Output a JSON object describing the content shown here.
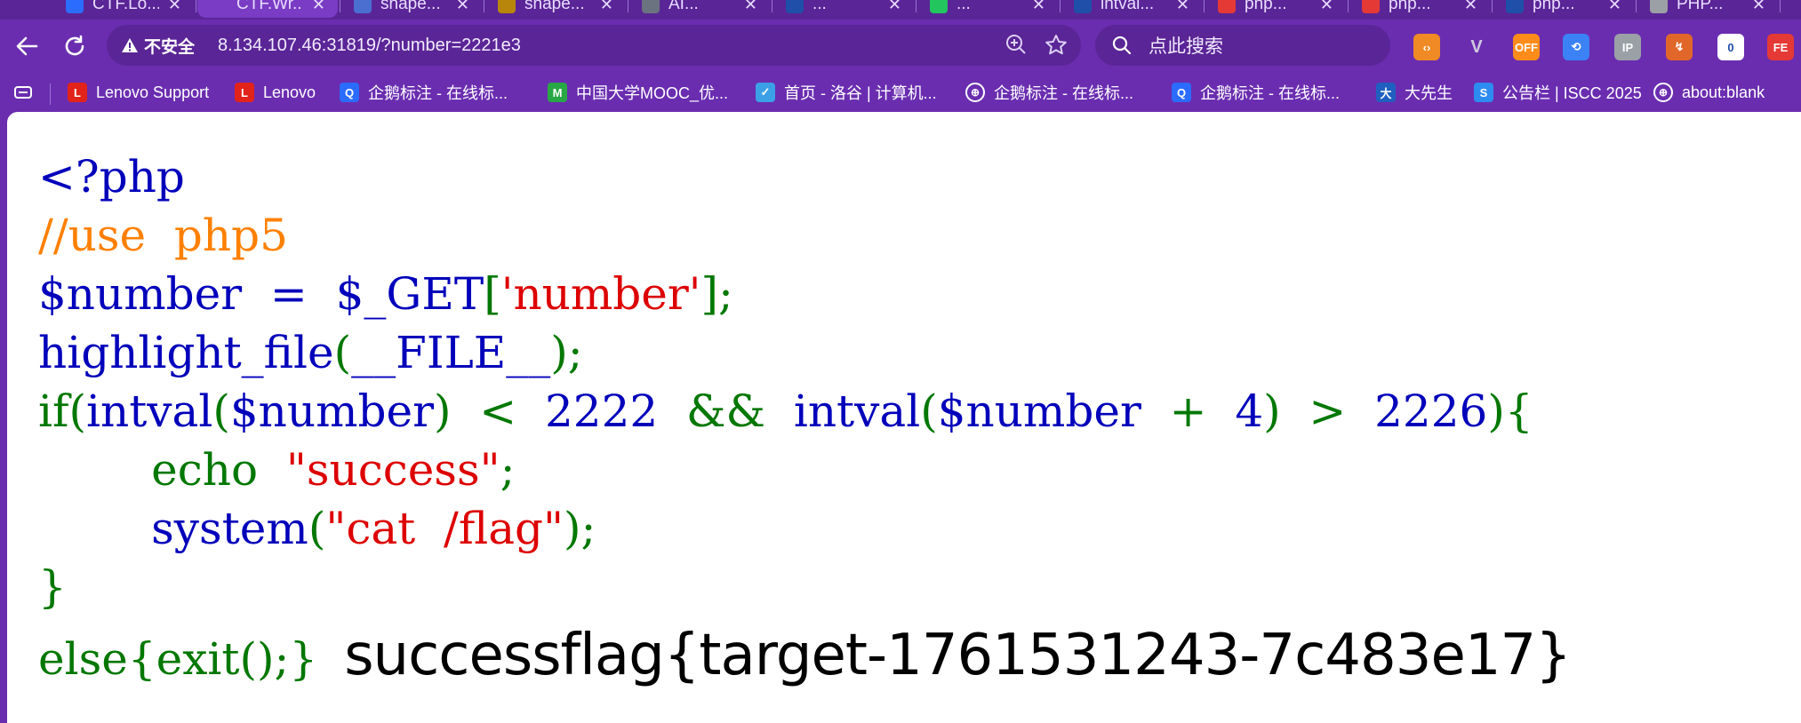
{
  "browser": {
    "tabs": [
      {
        "label": "CTF.Lo..."
      },
      {
        "label": "CTF.Wr..."
      },
      {
        "label": "shape..."
      },
      {
        "label": "shape..."
      },
      {
        "label": "AI..."
      },
      {
        "label": "..."
      },
      {
        "label": "..."
      },
      {
        "label": "intval..."
      },
      {
        "label": "php..."
      },
      {
        "label": "php..."
      },
      {
        "label": "php..."
      },
      {
        "label": "PHP..."
      }
    ],
    "security_label": "不安全",
    "url": "8.134.107.46:31819/?number=2221e3",
    "search_placeholder": "点此搜索",
    "extensions": [
      {
        "name": "orange-extension-icon",
        "text": "‹›",
        "color": "#f08a24"
      },
      {
        "name": "v-extension-icon",
        "text": "V",
        "color": "#6a2db0"
      },
      {
        "name": "off-extension-icon",
        "text": "OFF",
        "color": "#ff8c1a"
      },
      {
        "name": "share-extension-icon",
        "text": "⟲",
        "color": "#3b82f6"
      },
      {
        "name": "ip-extension-icon",
        "text": "IP",
        "color": "#9aa0a6"
      },
      {
        "name": "arrow-extension-icon",
        "text": "↯",
        "color": "#e0662a"
      },
      {
        "name": "qr-extension-icon",
        "text": "0",
        "color": "#ffffff"
      },
      {
        "name": "fe-extension-icon",
        "text": "FE",
        "color": "#e53935"
      },
      {
        "name": "puzzle-extension-icon",
        "text": "▣",
        "color": "#9aa0a6"
      }
    ]
  },
  "bookmarks": [
    {
      "label": "Lenovo Support",
      "icon": "lenovo-icon",
      "icon_text": "L",
      "color": "#e2231a"
    },
    {
      "label": "Lenovo",
      "icon": "lenovo-icon",
      "icon_text": "L",
      "color": "#e2231a"
    },
    {
      "label": "企鹅标注 - 在线标...",
      "icon": "qiehu-icon",
      "icon_text": "Q",
      "color": "#2b6cff"
    },
    {
      "label": "中国大学MOOC_优...",
      "icon": "mooc-icon",
      "icon_text": "M",
      "color": "#28a745"
    },
    {
      "label": "首页 - 洛谷 | 计算机...",
      "icon": "luogu-icon",
      "icon_text": "✓",
      "color": "#3ba0e6"
    },
    {
      "label": "企鹅标注 - 在线标...",
      "icon": "globe-icon",
      "icon_text": "⊕",
      "color": "transparent"
    },
    {
      "label": "企鹅标注 - 在线标...",
      "icon": "qiehu-icon",
      "icon_text": "Q",
      "color": "#2b6cff"
    },
    {
      "label": "大先生",
      "icon": "daxiansheng-icon",
      "icon_text": "大",
      "color": "#1f5fbf"
    },
    {
      "label": "公告栏 | ISCC 2025",
      "icon": "iscc-icon",
      "icon_text": "S",
      "color": "#2d8cf0"
    },
    {
      "label": "about:blank",
      "icon": "globe-icon",
      "icon_text": "⊕",
      "color": "transparent"
    }
  ],
  "page": {
    "code_lines": [
      [
        {
          "t": "<?php",
          "c": "default"
        }
      ],
      [
        {
          "t": "//use  php5",
          "c": "comment"
        }
      ],
      [
        {
          "t": "$number  =  $_GET",
          "c": "default"
        },
        {
          "t": "[",
          "c": "keyword"
        },
        {
          "t": "'number'",
          "c": "string"
        },
        {
          "t": "];",
          "c": "keyword"
        }
      ],
      [
        {
          "t": "highlight_file",
          "c": "default"
        },
        {
          "t": "(",
          "c": "keyword"
        },
        {
          "t": "__FILE__",
          "c": "default"
        },
        {
          "t": ");",
          "c": "keyword"
        }
      ],
      [
        {
          "t": "if(",
          "c": "keyword"
        },
        {
          "t": "intval",
          "c": "default"
        },
        {
          "t": "(",
          "c": "keyword"
        },
        {
          "t": "$number",
          "c": "default"
        },
        {
          "t": ")  <  ",
          "c": "keyword"
        },
        {
          "t": "2222  ",
          "c": "default"
        },
        {
          "t": "&&  ",
          "c": "keyword"
        },
        {
          "t": "intval",
          "c": "default"
        },
        {
          "t": "(",
          "c": "keyword"
        },
        {
          "t": "$number  ",
          "c": "default"
        },
        {
          "t": "+  ",
          "c": "keyword"
        },
        {
          "t": "4",
          "c": "default"
        },
        {
          "t": ")  >  ",
          "c": "keyword"
        },
        {
          "t": "2226",
          "c": "default"
        },
        {
          "t": "){",
          "c": "keyword"
        }
      ],
      [
        {
          "t": "        echo  ",
          "c": "keyword"
        },
        {
          "t": "\"success\"",
          "c": "string"
        },
        {
          "t": ";",
          "c": "keyword"
        }
      ],
      [
        {
          "t": "        system",
          "c": "default"
        },
        {
          "t": "(",
          "c": "keyword"
        },
        {
          "t": "\"cat  /flag\"",
          "c": "string"
        },
        {
          "t": ");",
          "c": "keyword"
        }
      ],
      [
        {
          "t": "}",
          "c": "keyword"
        }
      ]
    ],
    "last_code": "else{exit();}",
    "output": "successflag{target-1761531243-7c483e17}"
  }
}
